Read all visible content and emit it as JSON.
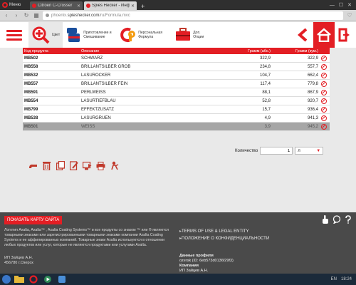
{
  "browser": {
    "menu_label": "Меню",
    "tabs": [
      {
        "title": "Citroen C-Crosser",
        "active": false
      },
      {
        "title": "Spies Hecker - Информа...",
        "active": true
      }
    ],
    "url_prefix": "phoenix.",
    "url_domain": "spieshecker.com",
    "url_suffix": "/ru/Formula.mvc"
  },
  "header": {
    "buttons": [
      {
        "label": "Цвет",
        "icon": "color-search-icon",
        "selected": true
      },
      {
        "label": "Приготовление и Смешивание",
        "icon": "mixing-cans-icon",
        "selected": false
      },
      {
        "label": "Персональная Формула",
        "icon": "personal-formula-icon",
        "selected": false
      },
      {
        "label": "Доп. Опции",
        "icon": "toolbox-icon",
        "selected": false
      }
    ],
    "right_icons": [
      "back-arrow-icon",
      "home-icon",
      "logout-icon"
    ]
  },
  "table": {
    "columns": [
      "Код продукта",
      "Описание",
      "Грамм (абс.)",
      "Грамм (кум.)"
    ],
    "rows": [
      {
        "code": "MB502",
        "description": "SCHWARZ",
        "abs": "322,9",
        "cum": "322,9",
        "selected": false
      },
      {
        "code": "MB558",
        "description": "BRILLANTSILBER GROB",
        "abs": "234,8",
        "cum": "557,7",
        "selected": false
      },
      {
        "code": "MB532",
        "description": "LASUROCKER",
        "abs": "104,7",
        "cum": "662,4",
        "selected": false
      },
      {
        "code": "MB557",
        "description": "BRILLANTSILBER FEIN",
        "abs": "117,4",
        "cum": "779,8",
        "selected": false
      },
      {
        "code": "MB591",
        "description": "PERLWEISS",
        "abs": "88,1",
        "cum": "867,9",
        "selected": false
      },
      {
        "code": "MB554",
        "description": "LASURTIEFBLAU",
        "abs": "52,8",
        "cum": "920,7",
        "selected": false
      },
      {
        "code": "MB799",
        "description": "EFFEKTZUSATZ",
        "abs": "15,7",
        "cum": "936,4",
        "selected": false
      },
      {
        "code": "MB538",
        "description": "LASURGRUEN",
        "abs": "4,9",
        "cum": "941,3",
        "selected": false
      },
      {
        "code": "MB501",
        "description": "WEISS",
        "abs": "3,9",
        "cum": "945,2",
        "selected": true
      }
    ]
  },
  "quantity": {
    "label": "Количество",
    "value": "1",
    "unit": "л"
  },
  "tools": [
    "scale-icon",
    "trash-icon",
    "copy-icon",
    "edit-icon",
    "export-icon",
    "print-icon",
    "settings-icon"
  ],
  "footer": {
    "map_button": "ПОКАЗАТЬ КАРТУ САЙТА",
    "legal": "Логотип Axalta, Axalta™ , Axalta Coating Systems™ и все продукты со знаком ™ или ® являются товарными знаками или зарегистрированными товарными знаками компании Axalta Coating Systems и ее аффилированных компаний. Товарные знаки Axalta используются в отношении любых продуктов или услуг, которые не являются продуктами или услугами Axalta.",
    "contact_name": "ИП Зайцев А.Н.",
    "contact_address": "456780 г.Озерск",
    "links": [
      "TERMS OF USE & LEGAL ENTITY",
      "ПОЛОЖЕНИЕ О КОНФИДЕНЦИАЛЬНОСТИ"
    ],
    "profile_title": "Данные профиля",
    "profile_id": "ozersk (ID: 6eb573d0136f29f3)",
    "company_title": "Компания",
    "company_name": "ИП Зайцев А.Н."
  },
  "taskbar": {
    "lang": "EN",
    "time": "18:24"
  },
  "colors": {
    "accent": "#e31e24",
    "footer": "#4a4a4a",
    "selected_row": "#a6a6a6"
  }
}
